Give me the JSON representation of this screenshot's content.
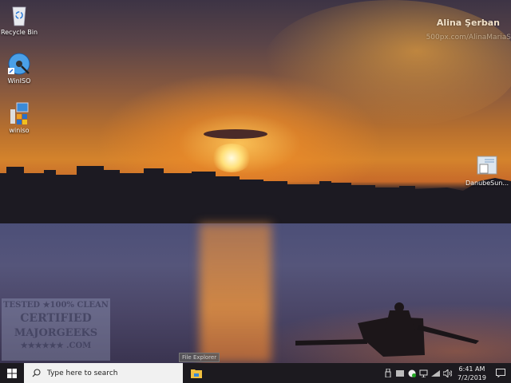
{
  "wallpaper": {
    "credit_name": "Alina Şerban",
    "credit_url": "500px.com/AlinaMariaS"
  },
  "desktop_icons": [
    {
      "label": "Recycle Bin",
      "icon": "recycle-bin-icon"
    },
    {
      "label": "WinISO",
      "icon": "winiso-disc-icon"
    },
    {
      "label": "winiso",
      "icon": "installer-icon"
    },
    {
      "label": "DanubeSun...",
      "icon": "image-file-icon"
    }
  ],
  "watermark": {
    "line1": "TESTED ★100% CLEAN",
    "line2": "CERTIFIED",
    "line3": "MAJORGEEKS",
    "line4": "★★★★★★ .COM"
  },
  "tooltip": "File Explorer",
  "taskbar": {
    "search_placeholder": "Type here to search",
    "time": "6:41 AM",
    "date": "7/2/2019"
  }
}
